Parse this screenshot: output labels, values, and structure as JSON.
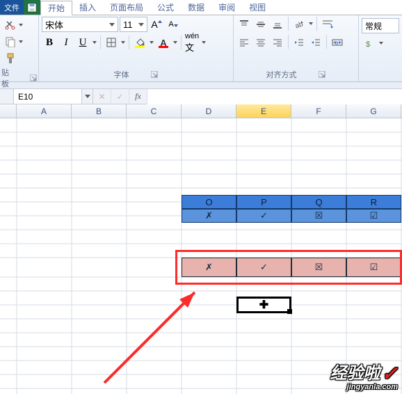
{
  "tabs": {
    "file": "文件",
    "home": "开始",
    "insert": "插入",
    "page_layout": "页面布局",
    "formulas": "公式",
    "data": "数据",
    "review": "审阅",
    "view": "视图"
  },
  "groups": {
    "clipboard": "贴板",
    "font": "字体",
    "align": "对齐方式"
  },
  "font": {
    "name": "宋体",
    "size": "11"
  },
  "number_group": "常规",
  "name_box": "E10",
  "columns": [
    "A",
    "B",
    "C",
    "D",
    "E",
    "F",
    "G"
  ],
  "selected_column": "E",
  "table": {
    "headers": [
      "O",
      "P",
      "Q",
      "R"
    ],
    "row_blue": [
      "✗",
      "✓",
      "☒",
      "☑"
    ],
    "row_pink": [
      "✗",
      "✓",
      "☒",
      "☑"
    ]
  },
  "watermark": {
    "big": "经验啦",
    "small": "jingyanla.com",
    "check": "✓"
  },
  "icons": {
    "dropdown": "▾",
    "grow_font": "A",
    "shrink_font": "A",
    "fx": "fx",
    "cancel": "✕",
    "enter": "✓",
    "cursor": "✚"
  }
}
